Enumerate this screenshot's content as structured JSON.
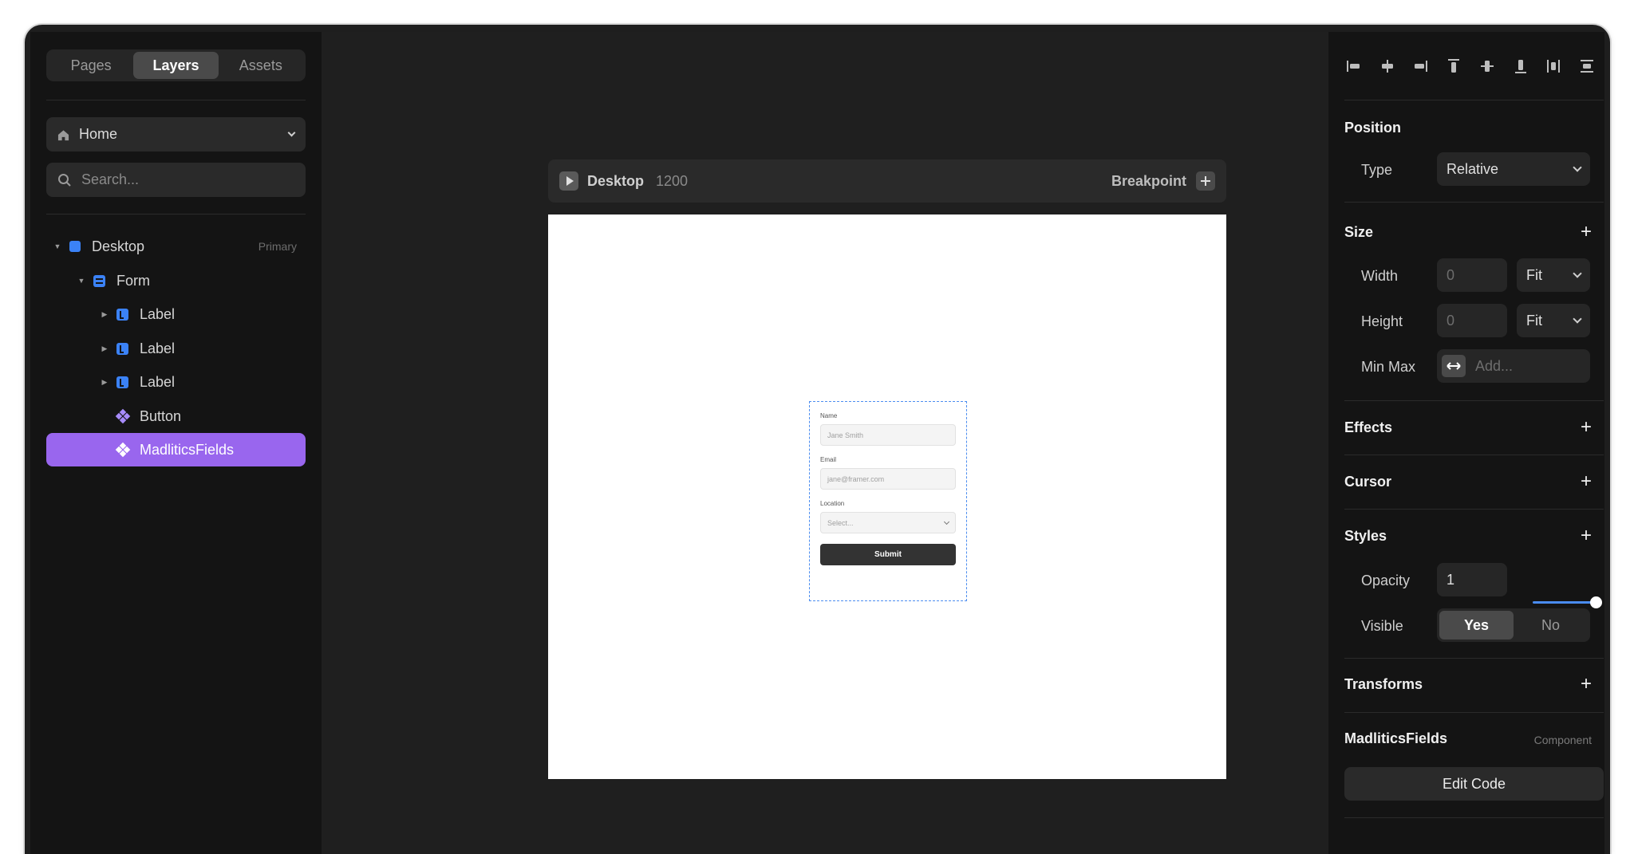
{
  "left": {
    "tabs": [
      "Pages",
      "Layers",
      "Assets"
    ],
    "page_select": "Home",
    "search_placeholder": "Search...",
    "layers": [
      {
        "name": "Desktop",
        "badge": "Primary"
      },
      {
        "name": "Form"
      },
      {
        "name": "Label"
      },
      {
        "name": "Label"
      },
      {
        "name": "Label"
      },
      {
        "name": "Button"
      },
      {
        "name": "MadliticsFields"
      }
    ]
  },
  "canvas": {
    "breakpoint_name": "Desktop",
    "breakpoint_width": "1200",
    "breakpoint_label": "Breakpoint",
    "form": {
      "name_label": "Name",
      "name_placeholder": "Jane Smith",
      "email_label": "Email",
      "email_placeholder": "jane@framer.com",
      "location_label": "Location",
      "location_placeholder": "Select...",
      "submit": "Submit"
    }
  },
  "right": {
    "position_title": "Position",
    "type_label": "Type",
    "type_value": "Relative",
    "size_title": "Size",
    "width_label": "Width",
    "width_value": "0",
    "width_mode": "Fit",
    "height_label": "Height",
    "height_value": "0",
    "height_mode": "Fit",
    "minmax_label": "Min Max",
    "minmax_placeholder": "Add...",
    "effects_title": "Effects",
    "cursor_title": "Cursor",
    "styles_title": "Styles",
    "opacity_label": "Opacity",
    "opacity_value": "1",
    "visible_label": "Visible",
    "visible_yes": "Yes",
    "visible_no": "No",
    "transforms_title": "Transforms",
    "component_name": "MadliticsFields",
    "component_badge": "Component",
    "edit_code": "Edit Code"
  },
  "colors": {
    "accent": "#9966ee",
    "blue": "#3b82f6",
    "panel": "#141414",
    "canvas": "#1f1f1f"
  }
}
